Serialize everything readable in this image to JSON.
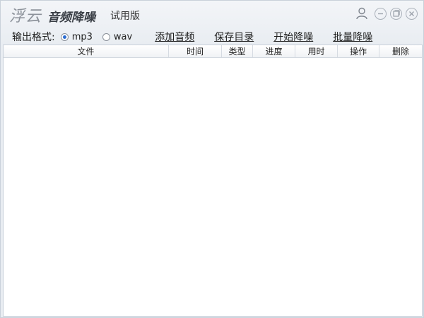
{
  "window": {
    "logo_text": "浮云",
    "app_name": "音频降噪",
    "edition": "试用版",
    "controls": {
      "user": "user-icon",
      "minimize": "minimize-icon",
      "maximize": "maximize-icon",
      "close": "close-icon"
    }
  },
  "toolbar": {
    "format_label": "输出格式:",
    "formats": [
      {
        "label": "mp3",
        "selected": true
      },
      {
        "label": "wav",
        "selected": false
      }
    ],
    "actions": [
      "添加音频",
      "保存目录",
      "开始降噪",
      "批量降噪"
    ]
  },
  "table": {
    "columns": [
      "文件",
      "时间",
      "类型",
      "进度",
      "用时",
      "操作",
      "删除"
    ],
    "rows": []
  },
  "colors": {
    "accent": "#2a6bd1",
    "title_text": "#3a3f46",
    "logo_text": "#8c929a"
  }
}
